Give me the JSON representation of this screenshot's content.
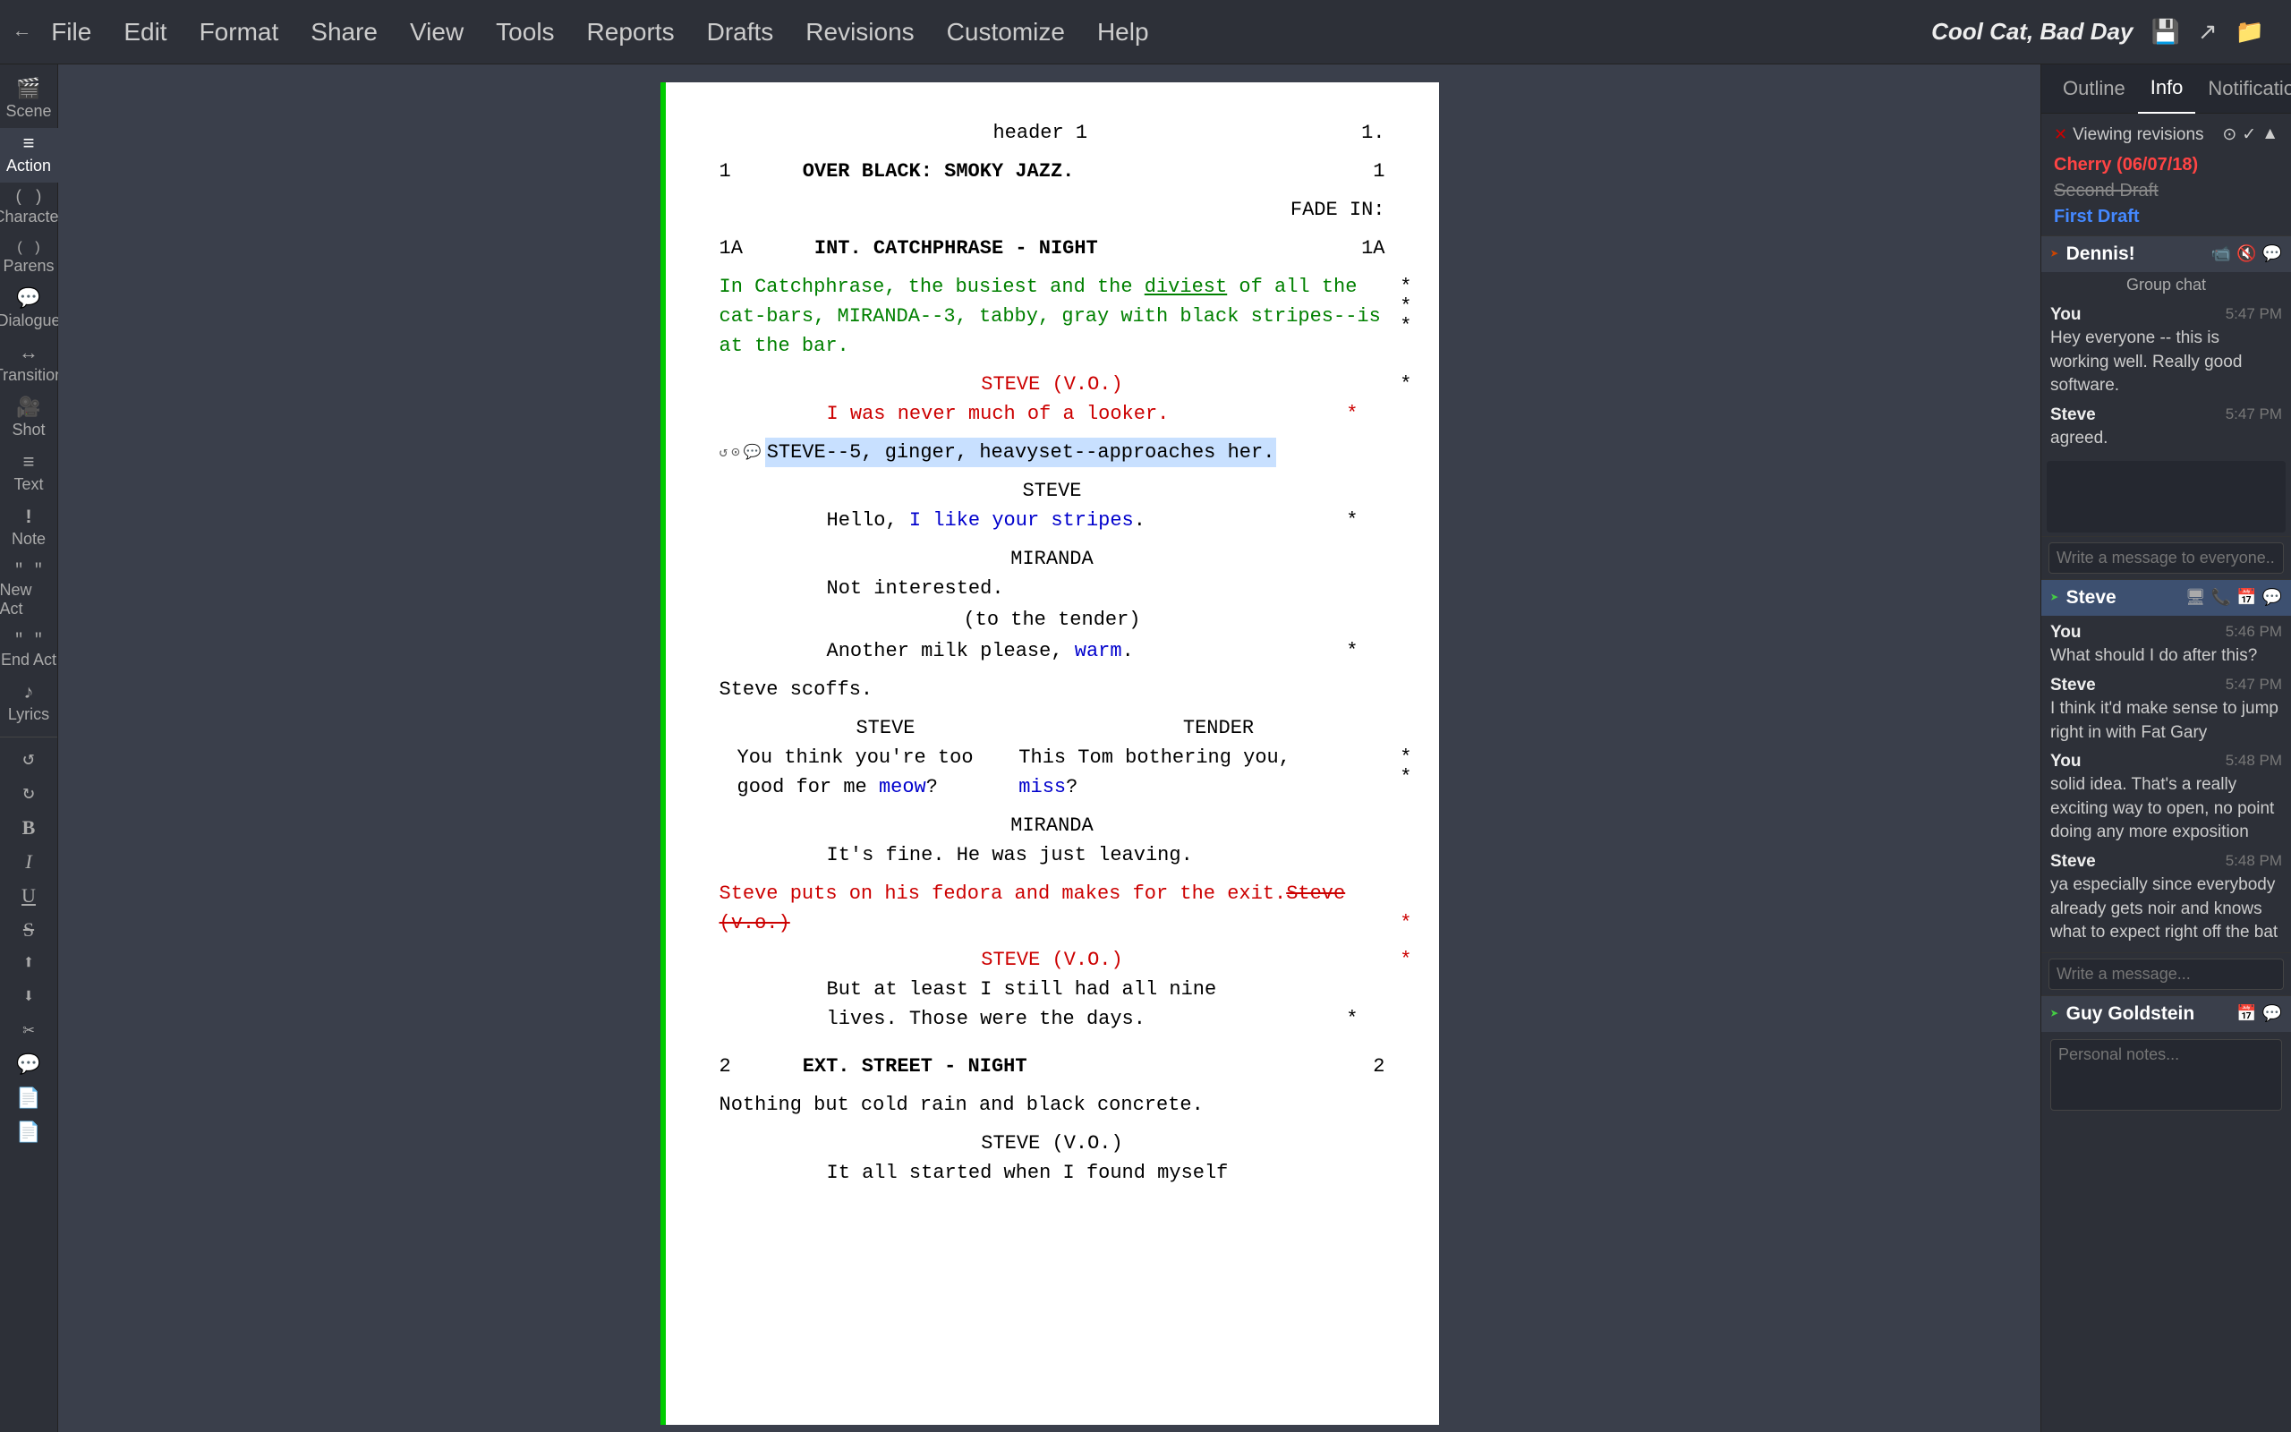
{
  "menu": {
    "items": [
      "File",
      "Edit",
      "Format",
      "Share",
      "View",
      "Tools",
      "Reports",
      "Drafts",
      "Revisions",
      "Customize",
      "Help"
    ]
  },
  "title": {
    "text": "Cool Cat, Bad Day",
    "save_icon": "💾",
    "share_icon": "↗",
    "folder_icon": "📁"
  },
  "sidebar": {
    "items": [
      {
        "label": "Scene",
        "icon": "🎬"
      },
      {
        "label": "Action",
        "icon": "≡"
      },
      {
        "label": "Character",
        "icon": "( )"
      },
      {
        "label": "Parens",
        "icon": "( )"
      },
      {
        "label": "Dialogue",
        "icon": "💬"
      },
      {
        "label": "Transition",
        "icon": "↔"
      },
      {
        "label": "Shot",
        "icon": "🎥"
      },
      {
        "label": "Text",
        "icon": "≡"
      },
      {
        "label": "Note",
        "icon": "!"
      },
      {
        "label": "New Act",
        "icon": "\"\""
      },
      {
        "label": "End Act",
        "icon": "\"\""
      },
      {
        "label": "Lyrics",
        "icon": "♪"
      },
      {
        "label": "Undo",
        "icon": "↺"
      },
      {
        "label": "Redo",
        "icon": "↻"
      },
      {
        "label": "Bold",
        "icon": "B"
      },
      {
        "label": "Italic",
        "icon": "I"
      },
      {
        "label": "Underline",
        "icon": "U"
      },
      {
        "label": "Strikethrough",
        "icon": "S̶"
      },
      {
        "label": "Upload",
        "icon": "⬆"
      },
      {
        "label": "Download",
        "icon": "⬇"
      },
      {
        "label": "Cut",
        "icon": "✂"
      },
      {
        "label": "Comment",
        "icon": "💬"
      },
      {
        "label": "Doc1",
        "icon": "📄"
      },
      {
        "label": "Doc2",
        "icon": "📄"
      }
    ]
  },
  "right_panel": {
    "tabs": [
      "Outline",
      "Info",
      "Notifications"
    ],
    "active_tab": "Info",
    "close_label": "—"
  },
  "revisions": {
    "title": "Viewing revisions",
    "items": [
      {
        "label": "Cherry (06/07/18)",
        "style": "cherry"
      },
      {
        "label": "Second Draft",
        "style": "second"
      },
      {
        "label": "First Draft",
        "style": "first"
      }
    ]
  },
  "chats": [
    {
      "user": "Dennis!",
      "icons": [
        "📹",
        "🔇",
        "💬"
      ],
      "group_chat_label": "Group chat",
      "messages": [
        {
          "sender": "You",
          "time": "5:47 PM",
          "text": "Hey everyone -- this is working well. Really good software."
        },
        {
          "sender": "Steve",
          "time": "5:47 PM",
          "text": "agreed."
        }
      ],
      "input_placeholder": "Write a message to everyone..."
    },
    {
      "user": "Steve",
      "icons": [
        "🖥",
        "📞",
        "📅",
        "💬"
      ],
      "messages": [
        {
          "sender": "You",
          "time": "5:46 PM",
          "text": "What should I do after this?"
        },
        {
          "sender": "Steve",
          "time": "5:47 PM",
          "text": "I think it'd make sense to jump right in with Fat Gary"
        },
        {
          "sender": "You",
          "time": "5:48 PM",
          "text": "solid idea. That's a really exciting way to open, no point doing any more exposition"
        },
        {
          "sender": "Steve",
          "time": "5:48 PM",
          "text": "ya especially since everybody already gets noir and knows what to expect right off the bat"
        }
      ],
      "input_placeholder": "Write a message..."
    },
    {
      "user": "Guy Goldstein",
      "icons": [
        "📅",
        "💬"
      ],
      "messages": []
    }
  ],
  "personal_notes": {
    "placeholder": "Personal notes..."
  },
  "script": {
    "header": "header 1",
    "header_page": "1.",
    "scenes": [
      {
        "number_left": "1",
        "heading": "OVER BLACK: SMOKY JAZZ.",
        "number_right": "1"
      },
      {
        "transition": "FADE IN:"
      },
      {
        "number_left": "1A",
        "heading": "INT. CATCHPHRASE - NIGHT",
        "number_right": "1A",
        "action": "In Catchphrase, the busiest and the diviest of all the cat-bars, MIRANDA--3, tabby, gray with black stripes--is at the bar.",
        "action_style": "green",
        "elements": [
          {
            "type": "character",
            "name": "STEVE (V.O.)"
          },
          {
            "type": "dialogue",
            "text": "I was never much of a looker.",
            "style": "red"
          },
          {
            "type": "action_with_icons",
            "text": "STEVE--5, ginger, heavyset--approaches her.",
            "selected": true
          },
          {
            "type": "character",
            "name": "STEVE"
          },
          {
            "type": "dialogue",
            "text": "Hello, I like your stripes.",
            "asterisk": true
          },
          {
            "type": "character",
            "name": "MIRANDA"
          },
          {
            "type": "dialogue",
            "text": "Not interested."
          },
          {
            "type": "parenthetical",
            "text": "(to the tender)"
          },
          {
            "type": "dialogue",
            "text": "Another milk please, warm.",
            "asterisk": true
          },
          {
            "type": "action",
            "text": "Steve scoffs."
          },
          {
            "type": "dual_character",
            "name1": "STEVE",
            "name2": "TENDER"
          },
          {
            "type": "dual_dialogue",
            "text1": "You think you're too good for me meow?",
            "text2": "This Tom bothering you, miss?",
            "asterisk": true
          },
          {
            "type": "character",
            "name": "MIRANDA"
          },
          {
            "type": "dialogue",
            "text": "It's fine. He was just leaving."
          },
          {
            "type": "action",
            "text": "Steve puts on his fedora and makes for the exit.",
            "style": "red",
            "strikethrough": "Steve (v.o.)",
            "asterisk": true
          },
          {
            "type": "character",
            "name": "STEVE (V.O.)",
            "style": "red"
          },
          {
            "type": "dialogue",
            "text": "But at least I still had all nine lives. Those were the days.",
            "asterisk": true
          }
        ]
      },
      {
        "number_left": "2",
        "heading": "EXT. STREET - NIGHT",
        "number_right": "2",
        "action": "Nothing but cold rain and black concrete.",
        "elements": [
          {
            "type": "character",
            "name": "STEVE (V.O.)"
          },
          {
            "type": "dialogue",
            "text": "It all started when I found myself"
          }
        ]
      }
    ]
  }
}
